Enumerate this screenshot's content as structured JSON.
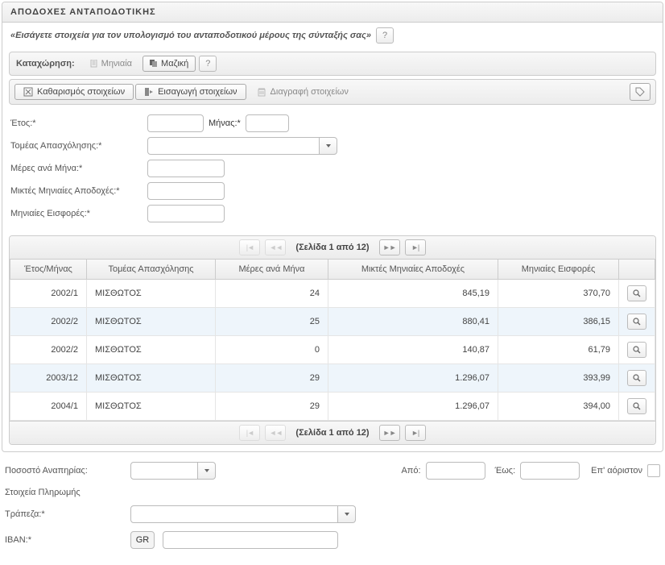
{
  "panel": {
    "title": "ΑΠΟΔΟΧΕΣ ΑΝΤΑΠΟΔΟΤΙΚΗΣ",
    "subtitle": "«Εισάγετε στοιχεία για τον υπολογισμό του ανταποδοτικού μέρους της σύνταξής σας»",
    "help": "?"
  },
  "entryBar": {
    "label": "Καταχώρηση:",
    "monthly": "Μηνιαία",
    "bulk": "Μαζική",
    "help": "?"
  },
  "toolbar": {
    "clear": "Καθαρισμός στοιχείων",
    "import": "Εισαγωγή στοιχείων",
    "delete": "Διαγραφή στοιχείων"
  },
  "form": {
    "year": "Έτος:*",
    "month": "Μήνας:*",
    "sector": "Τομέας Απασχόλησης:*",
    "daysPerMonth": "Μέρες ανά Μήνα:*",
    "grossMonthly": "Μικτές Μηνιαίες Αποδοχές:*",
    "monthlyContrib": "Μηνιαίες Εισφορές:*"
  },
  "pager": {
    "text": "(Σελίδα 1 από 12)"
  },
  "table": {
    "headers": {
      "yearMonth": "Έτος/Μήνας",
      "sector": "Τομέας Απασχόλησης",
      "days": "Μέρες ανά Μήνα",
      "gross": "Μικτές Μηνιαίες Αποδοχές",
      "contrib": "Μηνιαίες Εισφορές"
    },
    "rows": [
      {
        "ym": "2002/1",
        "sector": "ΜΙΣΘΩΤΟΣ",
        "days": "24",
        "gross": "845,19",
        "contrib": "370,70"
      },
      {
        "ym": "2002/2",
        "sector": "ΜΙΣΘΩΤΟΣ",
        "days": "25",
        "gross": "880,41",
        "contrib": "386,15"
      },
      {
        "ym": "2002/2",
        "sector": "ΜΙΣΘΩΤΟΣ",
        "days": "0",
        "gross": "140,87",
        "contrib": "61,79"
      },
      {
        "ym": "2003/12",
        "sector": "ΜΙΣΘΩΤΟΣ",
        "days": "29",
        "gross": "1.296,07",
        "contrib": "393,99"
      },
      {
        "ym": "2004/1",
        "sector": "ΜΙΣΘΩΤΟΣ",
        "days": "29",
        "gross": "1.296,07",
        "contrib": "394,00"
      }
    ]
  },
  "bottom": {
    "disability": "Ποσοστό Αναπηρίας:",
    "from": "Από:",
    "to": "Έως:",
    "indef": "Επ' αόριστον",
    "payment": "Στοιχεία Πληρωμής",
    "bank": "Τράπεζα:*",
    "iban": "IBAN:*",
    "ibanPrefix": "GR"
  }
}
